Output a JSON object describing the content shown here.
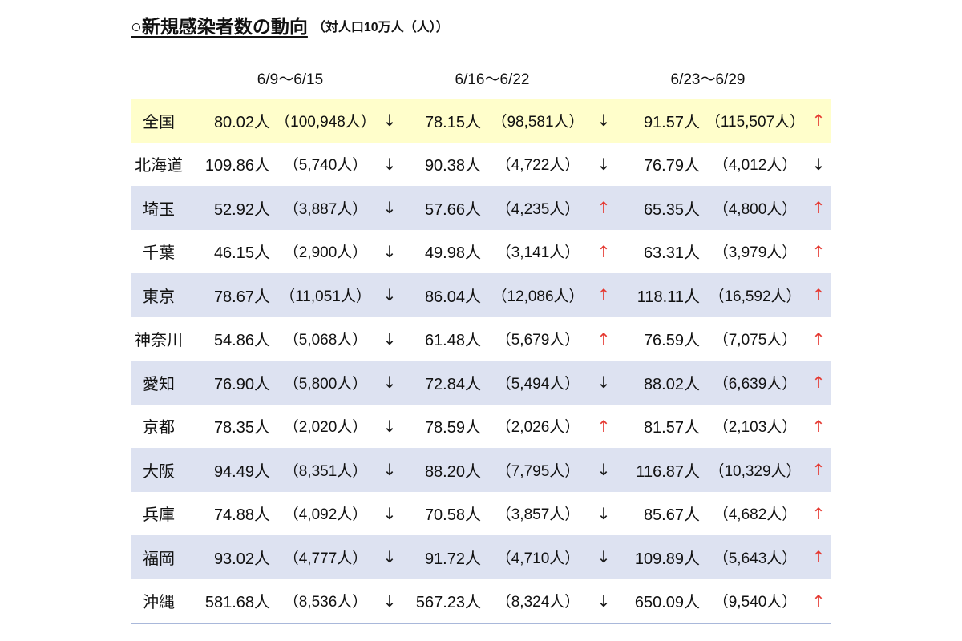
{
  "colors": {
    "text": "#111111",
    "highlight_row": "#fffecb",
    "band_row": "#dde2f1",
    "up_arrow": "#e5372f",
    "down_arrow": "#1a1a1a",
    "bottom_rule": "#a9b8da"
  },
  "chart_data": {
    "type": "table",
    "title": "○新規感染者数の動向",
    "subtitle": "（対人口10万人（人））",
    "unit": "人",
    "case_brackets": [
      "（",
      "）"
    ],
    "columns": [
      "6/9～6/15",
      "6/16～6/22",
      "6/23～6/29"
    ],
    "rows": [
      {
        "label": "全国",
        "values": [
          {
            "per_100k": 80.02,
            "cases": 100948,
            "trend": "↓"
          },
          {
            "per_100k": 78.15,
            "cases": 98581,
            "trend": "↓"
          },
          {
            "per_100k": 91.57,
            "cases": 115507,
            "trend": "↑"
          }
        ]
      },
      {
        "label": "北海道",
        "values": [
          {
            "per_100k": 109.86,
            "cases": 5740,
            "trend": "↓"
          },
          {
            "per_100k": 90.38,
            "cases": 4722,
            "trend": "↓"
          },
          {
            "per_100k": 76.79,
            "cases": 4012,
            "trend": "↓"
          }
        ]
      },
      {
        "label": "埼玉",
        "values": [
          {
            "per_100k": 52.92,
            "cases": 3887,
            "trend": "↓"
          },
          {
            "per_100k": 57.66,
            "cases": 4235,
            "trend": "↑"
          },
          {
            "per_100k": 65.35,
            "cases": 4800,
            "trend": "↑"
          }
        ]
      },
      {
        "label": "千葉",
        "values": [
          {
            "per_100k": 46.15,
            "cases": 2900,
            "trend": "↓"
          },
          {
            "per_100k": 49.98,
            "cases": 3141,
            "trend": "↑"
          },
          {
            "per_100k": 63.31,
            "cases": 3979,
            "trend": "↑"
          }
        ]
      },
      {
        "label": "東京",
        "values": [
          {
            "per_100k": 78.67,
            "cases": 11051,
            "trend": "↓"
          },
          {
            "per_100k": 86.04,
            "cases": 12086,
            "trend": "↑"
          },
          {
            "per_100k": 118.11,
            "cases": 16592,
            "trend": "↑"
          }
        ]
      },
      {
        "label": "神奈川",
        "values": [
          {
            "per_100k": 54.86,
            "cases": 5068,
            "trend": "↓"
          },
          {
            "per_100k": 61.48,
            "cases": 5679,
            "trend": "↑"
          },
          {
            "per_100k": 76.59,
            "cases": 7075,
            "trend": "↑"
          }
        ]
      },
      {
        "label": "愛知",
        "values": [
          {
            "per_100k": 76.9,
            "cases": 5800,
            "trend": "↓"
          },
          {
            "per_100k": 72.84,
            "cases": 5494,
            "trend": "↓"
          },
          {
            "per_100k": 88.02,
            "cases": 6639,
            "trend": "↑"
          }
        ]
      },
      {
        "label": "京都",
        "values": [
          {
            "per_100k": 78.35,
            "cases": 2020,
            "trend": "↓"
          },
          {
            "per_100k": 78.59,
            "cases": 2026,
            "trend": "↑"
          },
          {
            "per_100k": 81.57,
            "cases": 2103,
            "trend": "↑"
          }
        ]
      },
      {
        "label": "大阪",
        "values": [
          {
            "per_100k": 94.49,
            "cases": 8351,
            "trend": "↓"
          },
          {
            "per_100k": 88.2,
            "cases": 7795,
            "trend": "↓"
          },
          {
            "per_100k": 116.87,
            "cases": 10329,
            "trend": "↑"
          }
        ]
      },
      {
        "label": "兵庫",
        "values": [
          {
            "per_100k": 74.88,
            "cases": 4092,
            "trend": "↓"
          },
          {
            "per_100k": 70.58,
            "cases": 3857,
            "trend": "↓"
          },
          {
            "per_100k": 85.67,
            "cases": 4682,
            "trend": "↑"
          }
        ]
      },
      {
        "label": "福岡",
        "values": [
          {
            "per_100k": 93.02,
            "cases": 4777,
            "trend": "↓"
          },
          {
            "per_100k": 91.72,
            "cases": 4710,
            "trend": "↓"
          },
          {
            "per_100k": 109.89,
            "cases": 5643,
            "trend": "↑"
          }
        ]
      },
      {
        "label": "沖縄",
        "values": [
          {
            "per_100k": 581.68,
            "cases": 8536,
            "trend": "↓"
          },
          {
            "per_100k": 567.23,
            "cases": 8324,
            "trend": "↓"
          },
          {
            "per_100k": 650.09,
            "cases": 9540,
            "trend": "↑"
          }
        ]
      }
    ]
  }
}
